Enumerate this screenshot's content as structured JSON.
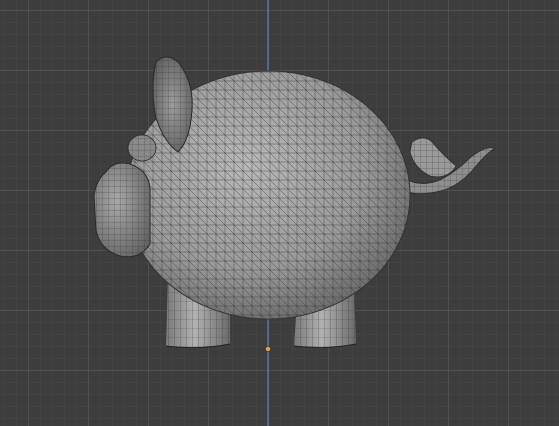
{
  "viewport": {
    "view_name": "",
    "object_name": ""
  },
  "colors": {
    "background": "#3d3d3d",
    "grid_minor": "#484848",
    "grid_major": "#5a5a5a",
    "axis_z": "#5b7fc4",
    "mesh_fill": "#9a9a9a",
    "mesh_shadow": "#6e6e6e",
    "wire": "#2e2e2e",
    "origin": "#e8a04a"
  },
  "icons": [
    "origin-point-icon"
  ]
}
